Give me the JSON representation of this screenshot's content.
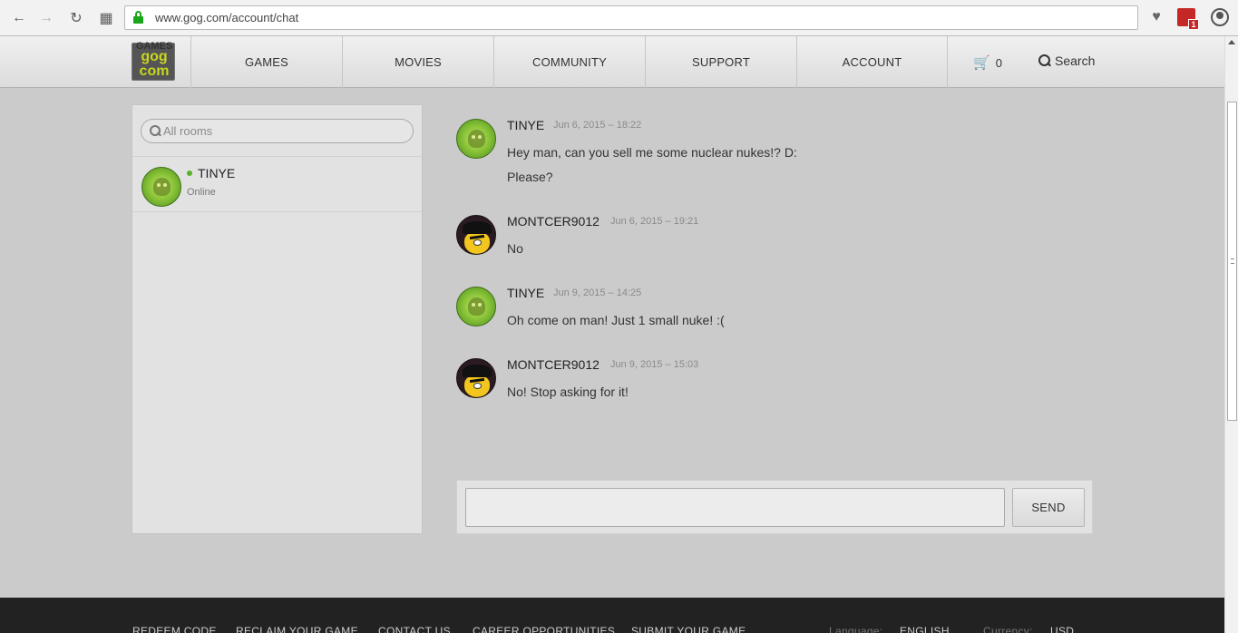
{
  "browser": {
    "url": "www.gog.com/account/chat"
  },
  "header": {
    "logo": {
      "line1": "GAMES",
      "line2": "gog",
      "line3": "com"
    },
    "menu": [
      "GAMES",
      "MOVIES",
      "COMMUNITY",
      "SUPPORT",
      "ACCOUNT"
    ],
    "cart_count": "0",
    "search_label": "Search"
  },
  "rooms": {
    "search_placeholder": "All rooms",
    "items": [
      {
        "name": "TINYE",
        "status": "Online"
      }
    ]
  },
  "messages": [
    {
      "author": "TINYE",
      "time": "Jun 6, 2015 – 18:22",
      "lines": [
        "Hey man, can you sell me some nuclear nukes!? D:",
        "Please?"
      ]
    },
    {
      "author": "MONTCER9012",
      "time": "Jun 6, 2015 – 19:21",
      "lines": [
        "No"
      ]
    },
    {
      "author": "TINYE",
      "time": "Jun 9, 2015 – 14:25",
      "lines": [
        "Oh come on man! Just 1 small nuke! :("
      ]
    },
    {
      "author": "MONTCER9012",
      "time": "Jun 9, 2015 – 15:03",
      "lines": [
        "No! Stop asking for it!"
      ]
    }
  ],
  "composer": {
    "value": "",
    "send_label": "SEND"
  },
  "footer": {
    "links": [
      "REDEEM CODE",
      "RECLAIM YOUR GAME",
      "CONTACT US",
      "CAREER OPPORTUNITIES",
      "SUBMIT YOUR GAME"
    ],
    "language_label": "Language:",
    "language_value": "ENGLISH",
    "currency_label": "Currency:",
    "currency_value": "USD"
  },
  "colors": {
    "online": "#56b22b",
    "page_bg": "#cbcbcb",
    "footer_bg": "#222222"
  }
}
